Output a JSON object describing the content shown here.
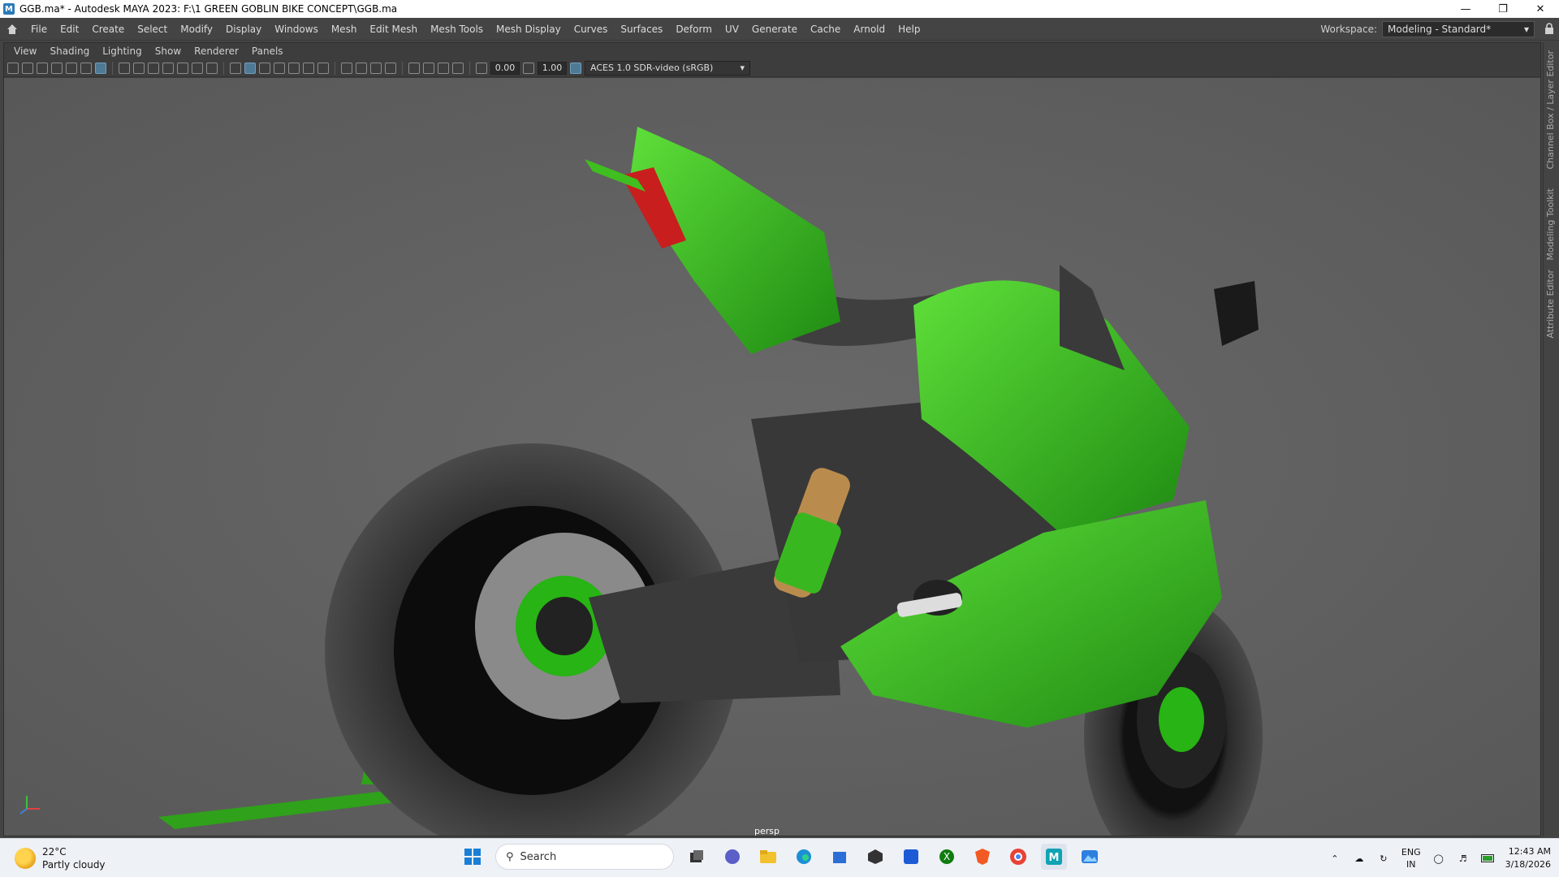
{
  "window": {
    "title": "GGB.ma* - Autodesk MAYA 2023: F:\\1 GREEN GOBLIN BIKE CONCEPT\\GGB.ma",
    "app_icon": "M",
    "controls": [
      "minimize-icon",
      "restore-icon",
      "close-icon"
    ]
  },
  "menubar": {
    "items": [
      "File",
      "Edit",
      "Create",
      "Select",
      "Modify",
      "Display",
      "Windows",
      "Mesh",
      "Edit Mesh",
      "Mesh Tools",
      "Mesh Display",
      "Curves",
      "Surfaces",
      "Deform",
      "UV",
      "Generate",
      "Cache",
      "Arnold",
      "Help"
    ],
    "workspace_label": "Workspace:",
    "workspace_value": "Modeling - Standard*"
  },
  "panel": {
    "menu": [
      "View",
      "Shading",
      "Lighting",
      "Show",
      "Renderer",
      "Panels"
    ],
    "exposure": "0.00",
    "gamma": "1.00",
    "color_space": "ACES 1.0 SDR-video (sRGB)",
    "camera_label": "persp"
  },
  "side_tabs": [
    "Channel Box / Layer Editor",
    "Modeling Toolkit",
    "Attribute Editor"
  ],
  "taskbar": {
    "weather_temp": "22°C",
    "weather_desc": "Partly cloudy",
    "search_placeholder": "Search",
    "language": "ENG",
    "region": "IN",
    "time": "12:43 AM",
    "date": "3/18/2026"
  },
  "colors": {
    "bike_green": "#3fbf1f",
    "viewport_bg": "#5f5f5f",
    "accent": "#5285a6"
  }
}
